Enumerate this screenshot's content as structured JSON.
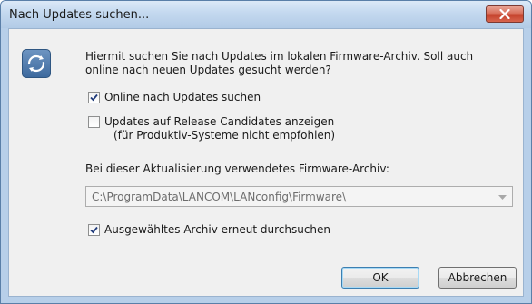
{
  "window": {
    "title": "Nach Updates suchen...",
    "close_icon": "close-icon"
  },
  "icon": {
    "name": "update-refresh-icon"
  },
  "message": "Hiermit suchen Sie nach Updates im lokalen Firmware-Archiv. Soll auch online nach neuen Updates gesucht werden?",
  "options": {
    "online": {
      "label": "Online nach Updates suchen",
      "checked": true
    },
    "release_candidates": {
      "label_line1": "Updates auf Release Candidates anzeigen",
      "label_line2": "(für Produktiv-Systeme nicht empfohlen)",
      "checked": false
    },
    "rescan": {
      "label": "Ausgewähltes Archiv erneut durchsuchen",
      "checked": true
    }
  },
  "archive": {
    "label": "Bei dieser Aktualisierung verwendetes Firmware-Archiv:",
    "path": "C:\\ProgramData\\LANCOM\\LANconfig\\Firmware\\"
  },
  "buttons": {
    "ok": "OK",
    "cancel": "Abbrechen"
  }
}
